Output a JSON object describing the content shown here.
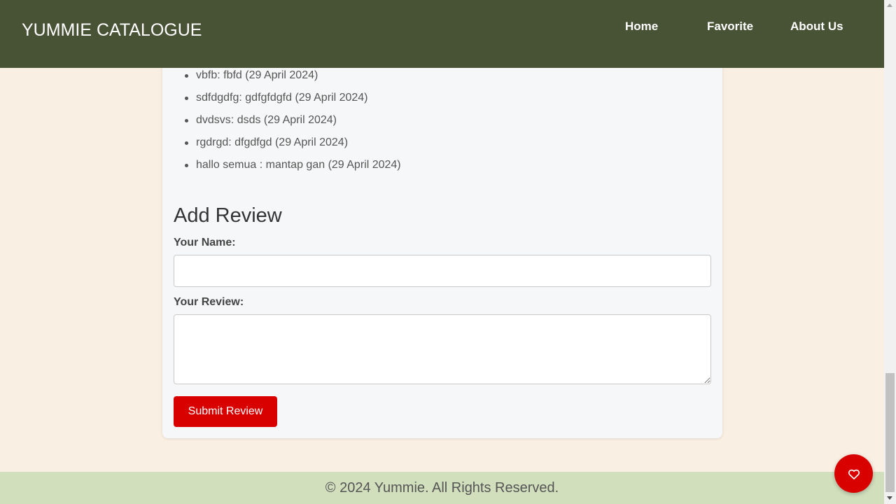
{
  "navbar": {
    "brand": "YUMMIE CATALOGUE",
    "links": [
      "Home",
      "Favorite",
      "About Us"
    ],
    "background": "#485235"
  },
  "reviews": [
    "vbfb: fbfd (29 April 2024)",
    "sdfdgdfg: gdfgfdgfd (29 April 2024)",
    "dvdsvs: dsds (29 April 2024)",
    "rgdrgd: dfgdfgd (29 April 2024)",
    "hallo semua : mantap gan (29 April 2024)"
  ],
  "form": {
    "title": "Add Review",
    "name_label": "Your Name:",
    "name_value": "",
    "review_label": "Your Review:",
    "review_value": "",
    "submit_label": "Submit Review",
    "accent": "#d90000"
  },
  "footer": {
    "text": "© 2024 Yummie. All Rights Reserved.",
    "background": "#d1dfbd"
  },
  "fab": {
    "icon": "heart-icon"
  }
}
